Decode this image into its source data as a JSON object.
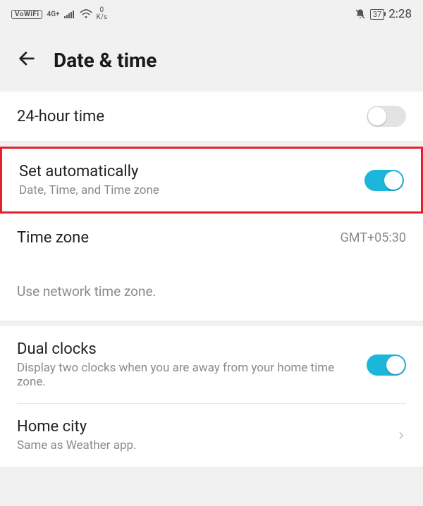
{
  "statusbar": {
    "vowifi": "VoWiFi",
    "signal_label": "4G+",
    "speed_top": "0",
    "speed_bottom": "K/s",
    "battery": "37",
    "clock": "2:28"
  },
  "header": {
    "title": "Date & time"
  },
  "rows": {
    "twenty_four": {
      "label": "24-hour time",
      "enabled": false
    },
    "set_auto": {
      "label": "Set automatically",
      "sub": "Date, Time, and Time zone",
      "enabled": true
    },
    "timezone": {
      "label": "Time zone",
      "value": "GMT+05:30"
    },
    "tz_hint": "Use network time zone.",
    "dual_clocks": {
      "label": "Dual clocks",
      "sub": "Display two clocks when you are away from your home time zone.",
      "enabled": true
    },
    "home_city": {
      "label": "Home city",
      "sub": "Same as Weather app."
    }
  }
}
